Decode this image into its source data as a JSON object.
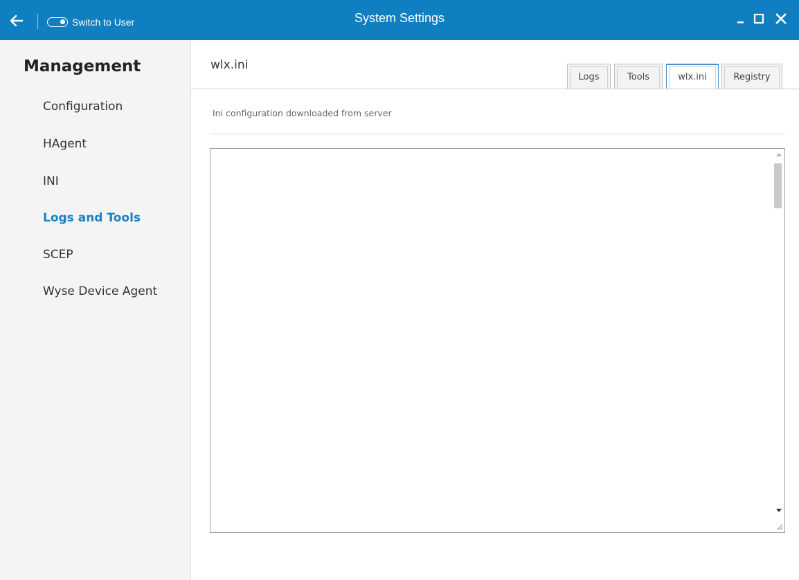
{
  "colors": {
    "titlebar": "#0f7fc2",
    "active_nav": "#1a82c4",
    "active_tab_border": "#4a90c8"
  },
  "titlebar": {
    "back_icon": "arrow-left-icon",
    "switch_label": "Switch to User",
    "switch_icon": "toggle-icon",
    "title": "System Settings",
    "minimize_icon": "minimize-icon",
    "maximize_icon": "maximize-icon",
    "close_icon": "close-icon"
  },
  "sidebar": {
    "title": "Management",
    "items": [
      {
        "label": "Configuration",
        "active": false
      },
      {
        "label": "HAgent",
        "active": false
      },
      {
        "label": "INI",
        "active": false
      },
      {
        "label": "Logs and Tools",
        "active": true
      },
      {
        "label": "SCEP",
        "active": false
      },
      {
        "label": "Wyse Device Agent",
        "active": false
      }
    ]
  },
  "main": {
    "title": "wlx.ini",
    "tabs": [
      {
        "label": "Logs",
        "active": false
      },
      {
        "label": "Tools",
        "active": false
      },
      {
        "label": "wlx.ini",
        "active": true
      },
      {
        "label": "Registry",
        "active": false
      }
    ],
    "section_description": "Ini configuration downloaded from server",
    "textarea_value": ""
  }
}
